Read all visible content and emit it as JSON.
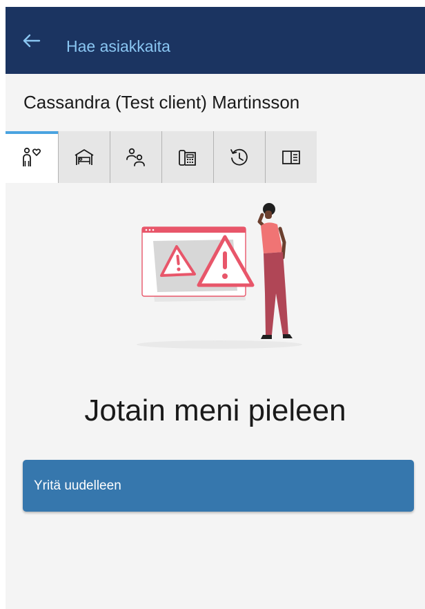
{
  "header": {
    "back_icon": "arrow-left-icon",
    "title": "Hae asiakkaita"
  },
  "client": {
    "name": "Cassandra (Test client) Martinsson"
  },
  "tabs": [
    {
      "icon": "person-heart-icon",
      "active": true
    },
    {
      "icon": "bed-home-icon",
      "active": false
    },
    {
      "icon": "people-icon",
      "active": false
    },
    {
      "icon": "phone-fax-icon",
      "active": false
    },
    {
      "icon": "history-icon",
      "active": false
    },
    {
      "icon": "side-panel-icon",
      "active": false
    }
  ],
  "error": {
    "illustration": "error-warning-illustration",
    "title": "Jotain meni pieleen",
    "retry_label": "Yritä uudelleen"
  },
  "colors": {
    "header_bg": "#1b3461",
    "header_text": "#8ac6f2",
    "active_tab_indicator": "#4aa3e0",
    "retry_button": "#3677ad",
    "warning_red": "#e8566a"
  }
}
